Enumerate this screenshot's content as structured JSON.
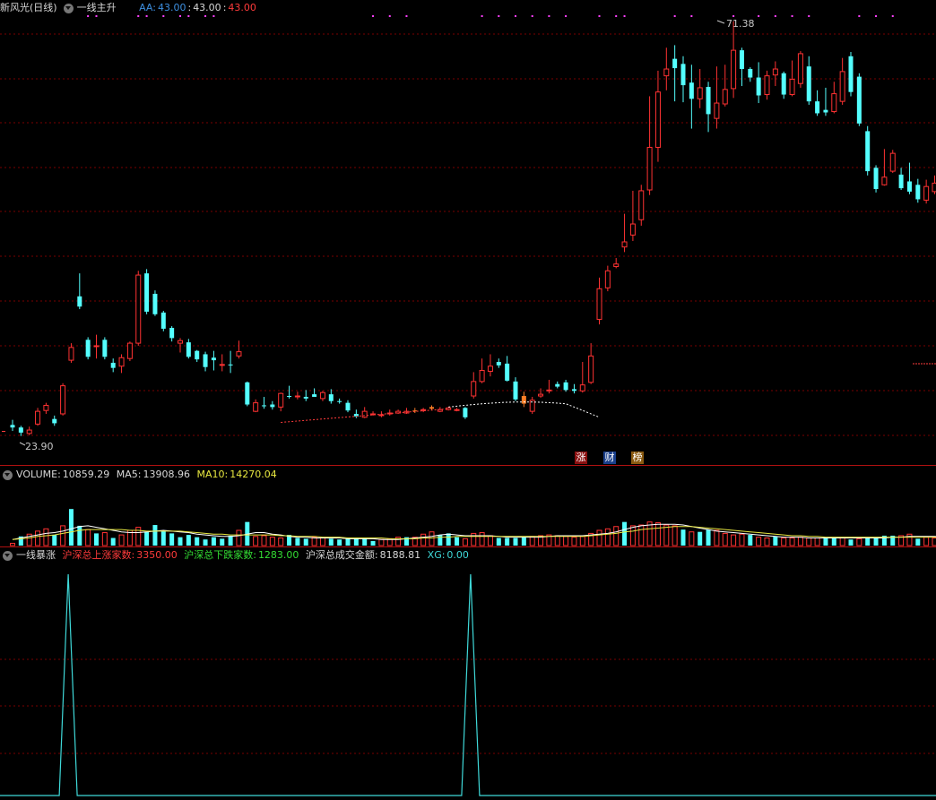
{
  "price_header": {
    "stock": "新风光(日线)",
    "indicator": "一线主升",
    "aa_label": "AA:",
    "aa_value": "43.00",
    "v2": "43.00",
    "v3": "43.00"
  },
  "price_markers": {
    "high": "71.38",
    "low": "23.90"
  },
  "badges": [
    "涨",
    "财",
    "榜"
  ],
  "volume_header": {
    "label": "VOLUME:",
    "value": "10859.29",
    "ma5_label": "MA5:",
    "ma5_value": "13908.96",
    "ma10_label": "MA10:",
    "ma10_value": "14270.04"
  },
  "indicator_header": {
    "name": "一线暴涨",
    "up_label": "沪深总上涨家数:",
    "up_value": "3350.00",
    "down_label": "沪深总下跌家数:",
    "down_value": "1283.00",
    "amount_label": "沪深总成交金额:",
    "amount_value": "8188.81",
    "xg_label": "XG:",
    "xg_value": "0.00"
  },
  "colors": {
    "up": "#ff3232",
    "down": "#54ffff",
    "grid": "#7a0000",
    "separator": "#b01010",
    "highlight": "#ff7f27",
    "ma5": "#ffffff",
    "ma10": "#e8e840",
    "signal": "#3fd9d9"
  },
  "chart_data": {
    "type": "candlestick",
    "price_range": [
      23.9,
      71.38
    ],
    "candles": [
      [
        25.2,
        24.9,
        25.8,
        24.5
      ],
      [
        24.9,
        24.3,
        25.1,
        23.9
      ],
      [
        24.2,
        24.6,
        25.0,
        24.0
      ],
      [
        25.3,
        26.8,
        27.2,
        25.1
      ],
      [
        26.9,
        27.5,
        27.8,
        26.5
      ],
      [
        25.9,
        25.4,
        26.3,
        25.1
      ],
      [
        26.5,
        29.8,
        30.1,
        26.3
      ],
      [
        32.8,
        34.3,
        34.8,
        32.5
      ],
      [
        40.3,
        39.1,
        43.0,
        38.8
      ],
      [
        35.2,
        33.2,
        35.5,
        32.9
      ],
      [
        34.5,
        34.5,
        35.8,
        33.0
      ],
      [
        35.2,
        33.2,
        35.5,
        32.9
      ],
      [
        32.5,
        31.9,
        33.0,
        31.4
      ],
      [
        32.1,
        33.1,
        33.5,
        31.3
      ],
      [
        33.0,
        34.8,
        35.0,
        32.7
      ],
      [
        34.8,
        42.8,
        43.3,
        34.5
      ],
      [
        43.0,
        38.5,
        43.5,
        38.2
      ],
      [
        40.6,
        38.2,
        41.0,
        38.0
      ],
      [
        38.4,
        36.5,
        38.6,
        36.2
      ],
      [
        36.6,
        35.4,
        36.8,
        35.0
      ],
      [
        34.8,
        35.1,
        35.4,
        33.7
      ],
      [
        34.9,
        33.2,
        35.3,
        33.0
      ],
      [
        33.9,
        32.9,
        34.0,
        32.6
      ],
      [
        33.5,
        32.0,
        33.8,
        31.5
      ],
      [
        33.1,
        32.8,
        33.9,
        31.6
      ],
      [
        32.2,
        32.3,
        33.5,
        31.5
      ],
      [
        32.3,
        32.2,
        33.9,
        31.3
      ],
      [
        33.3,
        33.8,
        35.1,
        33.0
      ],
      [
        30.2,
        27.6,
        30.3,
        27.4
      ],
      [
        26.8,
        27.8,
        28.2,
        26.7
      ],
      [
        27.5,
        27.4,
        28.5,
        27.1
      ],
      [
        27.6,
        27.3,
        28.0,
        27.0
      ],
      [
        27.3,
        28.9,
        29.0,
        26.8
      ],
      [
        28.6,
        28.5,
        29.8,
        28.3
      ],
      [
        28.6,
        28.6,
        29.1,
        28.2
      ],
      [
        28.5,
        28.3,
        29.3,
        28.0
      ],
      [
        28.8,
        28.5,
        29.5,
        28.6
      ],
      [
        28.3,
        29.0,
        29.2,
        28.0
      ],
      [
        28.8,
        28.0,
        29.4,
        27.7
      ],
      [
        28.0,
        27.9,
        28.3,
        27.7
      ],
      [
        27.8,
        26.9,
        28.1,
        26.7
      ],
      [
        26.5,
        26.2,
        27.0,
        26.0
      ],
      [
        26.1,
        26.8,
        27.3,
        26.0
      ],
      [
        26.5,
        26.5,
        26.8,
        26.3
      ],
      [
        26.4,
        26.4,
        26.8,
        26.1
      ],
      [
        26.6,
        26.6,
        27.0,
        26.3
      ],
      [
        26.6,
        26.8,
        27.0,
        26.5
      ],
      [
        26.6,
        26.8,
        27.2,
        26.5
      ],
      [
        26.8,
        26.9,
        27.2,
        26.6
      ],
      [
        26.9,
        27.0,
        27.2,
        26.7
      ],
      [
        27.3,
        27.1,
        27.5,
        26.9
      ],
      [
        26.8,
        27.0,
        27.3,
        26.7
      ],
      [
        27.0,
        27.2,
        27.3,
        26.9
      ],
      [
        26.9,
        27.0,
        27.2,
        26.8
      ],
      [
        27.2,
        26.1,
        27.3,
        25.9
      ],
      [
        28.6,
        30.3,
        31.4,
        28.3
      ],
      [
        30.3,
        31.6,
        33.0,
        30.1
      ],
      [
        31.5,
        32.1,
        33.5,
        30.9
      ],
      [
        32.6,
        32.2,
        33.0,
        31.9
      ],
      [
        32.4,
        30.4,
        33.3,
        30.3
      ],
      [
        30.3,
        28.2,
        30.8,
        28.0
      ],
      [
        28.6,
        27.7,
        29.1,
        27.3
      ],
      [
        26.8,
        28.1,
        28.5,
        26.5
      ],
      [
        28.6,
        28.8,
        29.5,
        28.4
      ],
      [
        29.2,
        29.3,
        30.5,
        28.9
      ],
      [
        30.0,
        29.7,
        30.3,
        29.5
      ],
      [
        30.2,
        29.3,
        30.5,
        29.1
      ],
      [
        29.4,
        29.2,
        30.0,
        28.9
      ],
      [
        29.2,
        29.9,
        32.6,
        29.0
      ],
      [
        30.2,
        33.3,
        34.8,
        30.0
      ],
      [
        37.6,
        41.2,
        42.5,
        37.0
      ],
      [
        41.3,
        43.3,
        43.9,
        40.9
      ],
      [
        43.8,
        44.1,
        44.8,
        43.6
      ],
      [
        46.1,
        46.7,
        50.0,
        45.5
      ],
      [
        47.5,
        48.8,
        52.7,
        46.8
      ],
      [
        49.3,
        52.7,
        53.4,
        48.6
      ],
      [
        52.8,
        57.8,
        63.8,
        52.2
      ],
      [
        57.8,
        64.3,
        66.8,
        56.1
      ],
      [
        66.2,
        67.0,
        69.5,
        64.5
      ],
      [
        68.2,
        67.1,
        69.8,
        63.2
      ],
      [
        67.6,
        65.1,
        68.5,
        63.1
      ],
      [
        65.4,
        63.5,
        67.5,
        60.0
      ],
      [
        63.5,
        64.8,
        67.0,
        62.4
      ],
      [
        64.9,
        61.7,
        65.5,
        59.6
      ],
      [
        61.2,
        63.0,
        67.3,
        60.0
      ],
      [
        62.9,
        64.6,
        67.5,
        62.6
      ],
      [
        64.7,
        69.2,
        72.6,
        63.6
      ],
      [
        69.2,
        67.0,
        69.5,
        65.0
      ],
      [
        67.0,
        66.0,
        67.2,
        65.5
      ],
      [
        66.0,
        63.9,
        67.8,
        63.0
      ],
      [
        64.0,
        66.2,
        66.8,
        63.4
      ],
      [
        66.3,
        67.0,
        67.9,
        65.0
      ],
      [
        66.5,
        64.0,
        66.7,
        63.5
      ],
      [
        64.0,
        65.8,
        68.0,
        63.8
      ],
      [
        65.3,
        68.8,
        69.1,
        64.8
      ],
      [
        67.3,
        63.2,
        68.5,
        62.8
      ],
      [
        63.2,
        61.8,
        64.5,
        61.5
      ],
      [
        62.2,
        61.9,
        64.8,
        61.5
      ],
      [
        62.0,
        64.1,
        65.5,
        61.8
      ],
      [
        63.2,
        66.7,
        68.3,
        62.8
      ],
      [
        68.5,
        64.3,
        69.0,
        63.8
      ],
      [
        66.1,
        60.6,
        66.5,
        60.3
      ],
      [
        59.7,
        55.0,
        60.3,
        54.5
      ],
      [
        55.4,
        52.9,
        55.7,
        52.5
      ],
      [
        53.4,
        54.3,
        57.6,
        53.3
      ],
      [
        55.0,
        57.1,
        57.5,
        54.8
      ],
      [
        54.6,
        53.0,
        55.4,
        52.8
      ],
      [
        53.8,
        52.6,
        56.0,
        52.3
      ],
      [
        53.4,
        51.7,
        54.1,
        51.3
      ],
      [
        51.6,
        53.2,
        54.0,
        51.2
      ],
      [
        52.6,
        53.6,
        54.5,
        52.3
      ],
      [
        54.6,
        54.0,
        56.1,
        53.7
      ]
    ],
    "volume": {
      "bars": [
        [
          3,
          0
        ],
        [
          12,
          1
        ],
        [
          15,
          0
        ],
        [
          19,
          0
        ],
        [
          22,
          0
        ],
        [
          14,
          1
        ],
        [
          26,
          0
        ],
        [
          48,
          1
        ],
        [
          26,
          1
        ],
        [
          21,
          0
        ],
        [
          16,
          1
        ],
        [
          17,
          0
        ],
        [
          10,
          1
        ],
        [
          14,
          0
        ],
        [
          20,
          0
        ],
        [
          24,
          0
        ],
        [
          18,
          1
        ],
        [
          27,
          1
        ],
        [
          20,
          1
        ],
        [
          16,
          1
        ],
        [
          11,
          1
        ],
        [
          14,
          1
        ],
        [
          11,
          1
        ],
        [
          8,
          1
        ],
        [
          11,
          1
        ],
        [
          9,
          1
        ],
        [
          13,
          1
        ],
        [
          20,
          0
        ],
        [
          31,
          1
        ],
        [
          12,
          0
        ],
        [
          13,
          0
        ],
        [
          11,
          0
        ],
        [
          10,
          0
        ],
        [
          14,
          1
        ],
        [
          10,
          1
        ],
        [
          9,
          1
        ],
        [
          11,
          0
        ],
        [
          10,
          0
        ],
        [
          9,
          1
        ],
        [
          8,
          1
        ],
        [
          9,
          1
        ],
        [
          9,
          1
        ],
        [
          9,
          1
        ],
        [
          6,
          1
        ],
        [
          8,
          0
        ],
        [
          9,
          0
        ],
        [
          11,
          0
        ],
        [
          11,
          1
        ],
        [
          11,
          0
        ],
        [
          15,
          0
        ],
        [
          18,
          0
        ],
        [
          14,
          1
        ],
        [
          16,
          1
        ],
        [
          11,
          1
        ],
        [
          9,
          0
        ],
        [
          16,
          0
        ],
        [
          17,
          0
        ],
        [
          13,
          0
        ],
        [
          10,
          1
        ],
        [
          10,
          1
        ],
        [
          10,
          1
        ],
        [
          11,
          1
        ],
        [
          12,
          0
        ],
        [
          13,
          0
        ],
        [
          14,
          0
        ],
        [
          13,
          0
        ],
        [
          12,
          0
        ],
        [
          11,
          0
        ],
        [
          12,
          0
        ],
        [
          16,
          0
        ],
        [
          20,
          0
        ],
        [
          22,
          0
        ],
        [
          25,
          0
        ],
        [
          31,
          1
        ],
        [
          26,
          0
        ],
        [
          27,
          0
        ],
        [
          31,
          0
        ],
        [
          30,
          0
        ],
        [
          27,
          0
        ],
        [
          26,
          0
        ],
        [
          21,
          1
        ],
        [
          18,
          0
        ],
        [
          18,
          1
        ],
        [
          21,
          1
        ],
        [
          20,
          0
        ],
        [
          16,
          0
        ],
        [
          14,
          0
        ],
        [
          15,
          0
        ],
        [
          14,
          1
        ],
        [
          11,
          0
        ],
        [
          10,
          0
        ],
        [
          12,
          1
        ],
        [
          10,
          0
        ],
        [
          10,
          0
        ],
        [
          11,
          0
        ],
        [
          10,
          0
        ],
        [
          10,
          0
        ],
        [
          11,
          1
        ],
        [
          11,
          1
        ],
        [
          10,
          0
        ],
        [
          8,
          1
        ],
        [
          9,
          0
        ],
        [
          10,
          1
        ],
        [
          11,
          1
        ],
        [
          13,
          1
        ],
        [
          13,
          1
        ],
        [
          13,
          0
        ],
        [
          15,
          0
        ],
        [
          9,
          1
        ],
        [
          11,
          0
        ],
        [
          10,
          0
        ],
        [
          11,
          1
        ],
        [
          9,
          1
        ]
      ],
      "ma5": [
        8,
        10,
        12,
        14,
        16,
        17,
        19,
        22,
        25,
        26,
        24,
        22,
        20,
        18,
        17,
        17,
        18,
        19,
        20,
        19,
        18,
        17,
        15,
        14,
        13,
        12,
        12,
        13,
        15,
        17,
        17,
        15,
        14,
        12,
        11,
        11,
        10,
        10,
        10,
        10,
        9,
        9,
        9,
        9,
        8,
        8,
        8,
        9,
        10,
        11,
        12,
        14,
        15,
        14,
        13,
        13,
        13,
        13,
        12,
        11,
        11,
        11,
        11,
        11,
        12,
        13,
        13,
        13,
        13,
        14,
        15,
        16,
        18,
        21,
        24,
        26,
        27,
        28,
        28,
        28,
        27,
        25,
        23,
        21,
        19,
        18,
        17,
        16,
        15,
        14,
        13,
        12,
        11,
        11,
        11,
        10,
        10,
        10,
        10,
        10,
        10,
        10,
        10,
        10,
        10,
        11,
        11,
        12,
        12,
        12,
        12,
        11
      ],
      "ma10": [
        8,
        9,
        10,
        12,
        13,
        14,
        16,
        18,
        20,
        21,
        21,
        21,
        21,
        21,
        20,
        20,
        19,
        19,
        19,
        19,
        19,
        18,
        17,
        16,
        15,
        15,
        14,
        14,
        14,
        14,
        14,
        14,
        13,
        13,
        12,
        12,
        12,
        11,
        11,
        11,
        10,
        10,
        10,
        10,
        10,
        9,
        9,
        9,
        9,
        10,
        10,
        11,
        11,
        12,
        12,
        12,
        12,
        12,
        12,
        12,
        12,
        12,
        12,
        12,
        12,
        12,
        12,
        12,
        12,
        13,
        14,
        15,
        16,
        18,
        19,
        21,
        22,
        23,
        24,
        25,
        25,
        25,
        24,
        23,
        22,
        21,
        20,
        19,
        18,
        17,
        16,
        15,
        14,
        13,
        13,
        12,
        12,
        11,
        11,
        11,
        11,
        11,
        11,
        11,
        11,
        11,
        11,
        11,
        11,
        11,
        11,
        11
      ]
    },
    "indicator": {
      "type": "line",
      "name": "XG",
      "spike_candle_indices": [
        6,
        54
      ]
    }
  }
}
